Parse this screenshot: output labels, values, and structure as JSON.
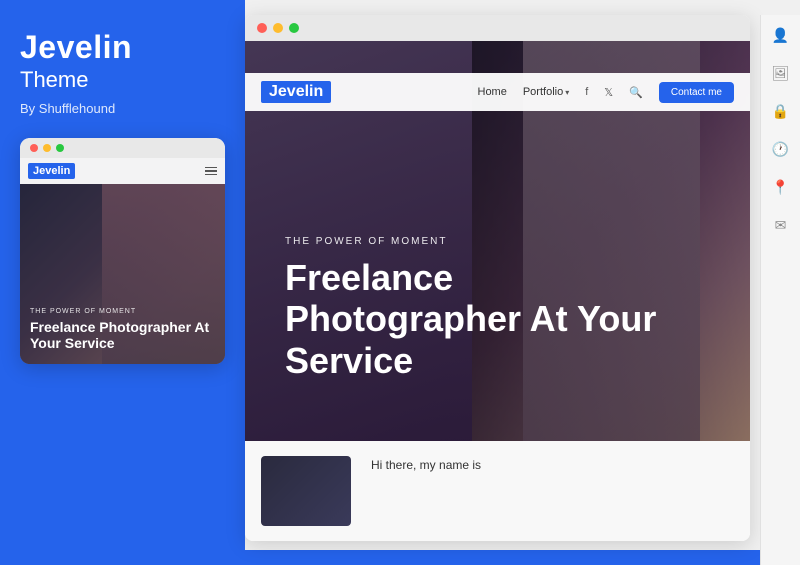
{
  "leftPanel": {
    "title": "Jevelin",
    "subtitle": "Theme",
    "by": "By Shufflehound"
  },
  "mobileBrowser": {
    "dots": [
      "red",
      "yellow",
      "green"
    ]
  },
  "mobileNav": {
    "logo": "Jevelin"
  },
  "mobileHero": {
    "powerText": "THE POWER OF MOMENT",
    "headline": "Freelance Photographer At Your Service"
  },
  "desktopBrowser": {
    "dots": [
      "red",
      "yellow",
      "green"
    ]
  },
  "desktopNav": {
    "logo": "Jevelin",
    "links": [
      "Home",
      "Portfolio",
      "Contact me"
    ],
    "contactBtn": "Contact me"
  },
  "desktopHero": {
    "powerText": "THE POWER OF MOMENT",
    "headline": "Freelance Photographer At Your Service"
  },
  "belowHero": {
    "text": "Hi there, my name is"
  },
  "iconBar": {
    "icons": [
      "person",
      "image",
      "lock",
      "clock",
      "pin",
      "mail"
    ]
  }
}
